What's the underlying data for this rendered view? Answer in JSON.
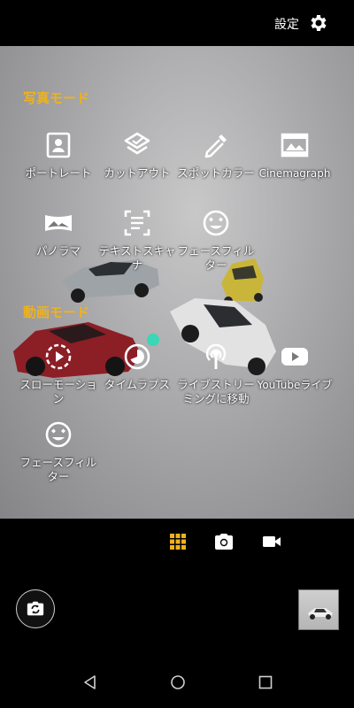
{
  "header": {
    "settings_label": "設定"
  },
  "sections": {
    "photo_title": "写真モード",
    "video_title": "動画モード"
  },
  "photo_modes": [
    {
      "label": "ポートレート",
      "icon": "portrait-icon"
    },
    {
      "label": "カットアウト",
      "icon": "cutout-icon"
    },
    {
      "label": "スポットカラー",
      "icon": "dropper-icon"
    },
    {
      "label": "Cinemagraph",
      "icon": "cinemagraph-icon"
    },
    {
      "label": "パノラマ",
      "icon": "panorama-icon"
    },
    {
      "label": "テキストスキャナ",
      "icon": "text-scanner-icon"
    },
    {
      "label": "フェースフィルター",
      "icon": "face-filter-icon"
    }
  ],
  "video_modes": [
    {
      "label": "スローモーション",
      "icon": "slow-motion-icon"
    },
    {
      "label": "タイムラプス",
      "icon": "timelapse-icon"
    },
    {
      "label": "ライブストリーミングに移動",
      "icon": "live-stream-icon"
    },
    {
      "label": "YouTubeライブ",
      "icon": "youtube-icon"
    },
    {
      "label": "フェースフィルター",
      "icon": "face-filter-icon"
    }
  ],
  "bottom_tabs": [
    {
      "name": "modes-grid",
      "icon": "grid-icon",
      "active": true
    },
    {
      "name": "photo",
      "icon": "camera-icon",
      "active": false
    },
    {
      "name": "video",
      "icon": "video-icon",
      "active": false
    }
  ],
  "colors": {
    "accent": "#f0b21b",
    "focus_dot": "#3ad6b5"
  }
}
